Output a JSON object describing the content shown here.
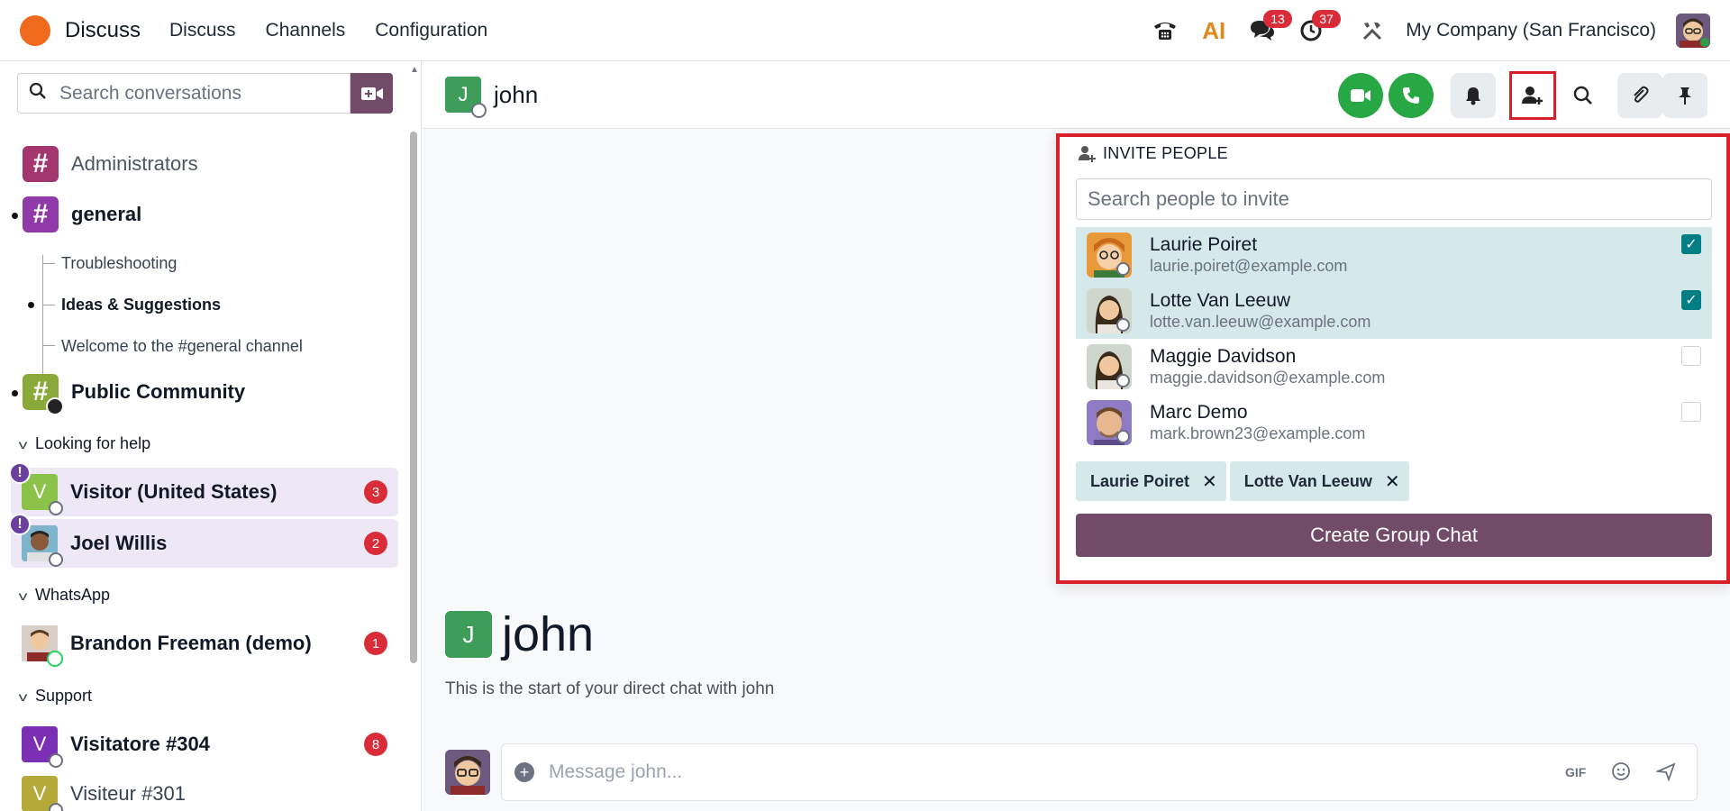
{
  "topbar": {
    "app_name": "Discuss",
    "menu": [
      "Discuss",
      "Channels",
      "Configuration"
    ],
    "messages_count": "13",
    "activities_count": "37",
    "company": "My Company (San Francisco)",
    "ai_label": "AI"
  },
  "sidebar": {
    "search_placeholder": "Search conversations",
    "channels": [
      {
        "name": "Administrators",
        "color": "#a3366f"
      },
      {
        "name": "general",
        "color": "#8f3aa8"
      }
    ],
    "sub_channels": [
      "Troubleshooting",
      "Ideas & Suggestions",
      "Welcome to the #general channel"
    ],
    "public_channel": {
      "name": "Public Community",
      "color": "#8ba83a"
    },
    "sections": {
      "looking_for_help": "Looking for help",
      "whatsapp": "WhatsApp",
      "support": "Support"
    },
    "conversations": [
      {
        "initial": "V",
        "name": "Visitor (United States)",
        "count": "3",
        "color": "#8bc34a"
      },
      {
        "initial": "",
        "name": "Joel Willis",
        "count": "2",
        "color": "#5b8fa8"
      },
      {
        "initial": "",
        "name": "Brandon Freeman (demo)",
        "count": "1",
        "color": "#c9b8a6"
      },
      {
        "initial": "V",
        "name": "Visitatore #304",
        "count": "8",
        "color": "#7b2fb5"
      },
      {
        "initial": "V",
        "name": "Visiteur #301",
        "count": "",
        "color": "#b5a93a"
      }
    ]
  },
  "chat": {
    "header_initial": "J",
    "header_name": "john",
    "intro_initial": "J",
    "intro_name": "john",
    "intro_text": "This is the start of your direct chat with john",
    "composer_placeholder": "Message john...",
    "gif_label": "GIF"
  },
  "invite": {
    "title": "INVITE PEOPLE",
    "search_placeholder": "Search people to invite",
    "people": [
      {
        "name": "Laurie Poiret",
        "email": "laurie.poiret@example.com",
        "selected": true
      },
      {
        "name": "Lotte Van Leeuw",
        "email": "lotte.van.leeuw@example.com",
        "selected": true
      },
      {
        "name": "Maggie Davidson",
        "email": "maggie.davidson@example.com",
        "selected": false
      },
      {
        "name": "Marc Demo",
        "email": "mark.brown23@example.com",
        "selected": false
      }
    ],
    "tags": [
      "Laurie Poiret",
      "Lotte Van Leeuw"
    ],
    "create_label": "Create Group Chat"
  },
  "colors": {
    "brand": "#714b67",
    "accent_teal": "#017e84",
    "badge_red": "#d92c38",
    "call_green": "#28a745",
    "highlight_frame": "#d9202a"
  }
}
